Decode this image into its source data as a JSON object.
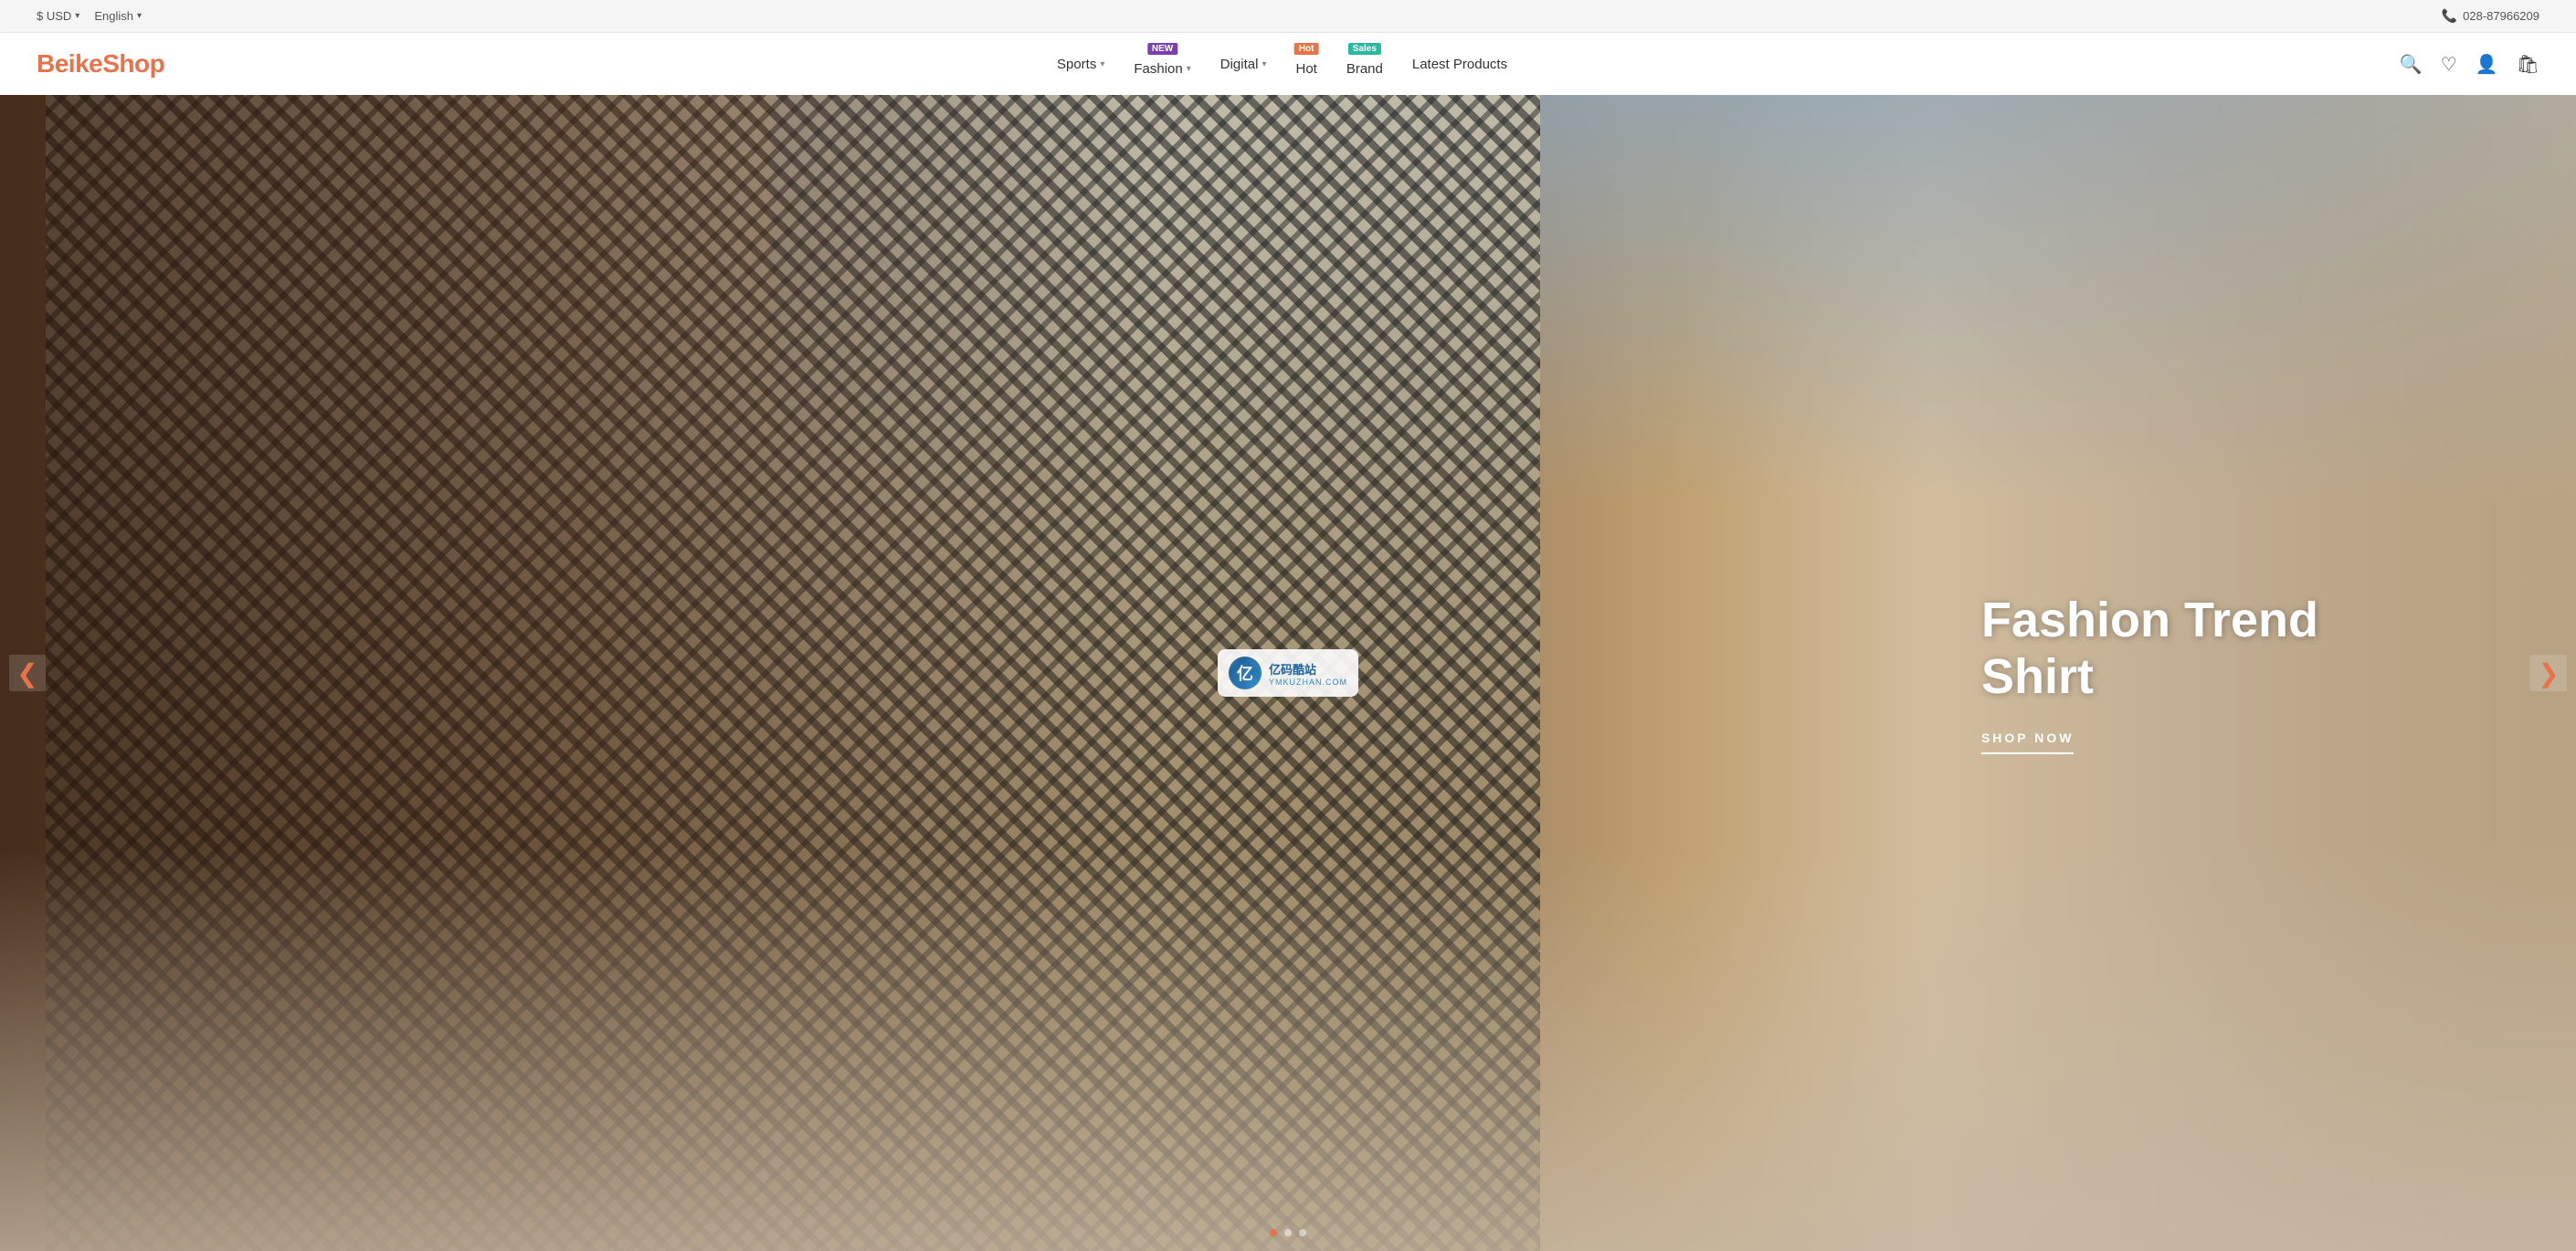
{
  "topbar": {
    "currency_label": "$ USD",
    "language_label": "English",
    "phone_number": "028-87966209"
  },
  "header": {
    "logo": "BeikeShop",
    "nav": [
      {
        "id": "sports",
        "label": "Sports",
        "has_dropdown": true,
        "badge": null
      },
      {
        "id": "fashion",
        "label": "Fashion",
        "has_dropdown": true,
        "badge": "NEW",
        "badge_type": "new"
      },
      {
        "id": "digital",
        "label": "Digital",
        "has_dropdown": true,
        "badge": null
      },
      {
        "id": "hot",
        "label": "Hot",
        "has_dropdown": false,
        "badge": "Hot",
        "badge_type": "hot"
      },
      {
        "id": "brand",
        "label": "Brand",
        "has_dropdown": false,
        "badge": "Sales",
        "badge_type": "sales"
      },
      {
        "id": "latest",
        "label": "Latest Products",
        "has_dropdown": false,
        "badge": null
      }
    ]
  },
  "hero": {
    "title_line1": "Fashion Trend",
    "title_line2": "Shirt",
    "cta_label": "SHOP NOW",
    "watermark_text1": "亿码酷站",
    "watermark_text2": "YMKUZHAN.COM",
    "dots": [
      {
        "active": true
      },
      {
        "active": false
      },
      {
        "active": false
      }
    ]
  }
}
